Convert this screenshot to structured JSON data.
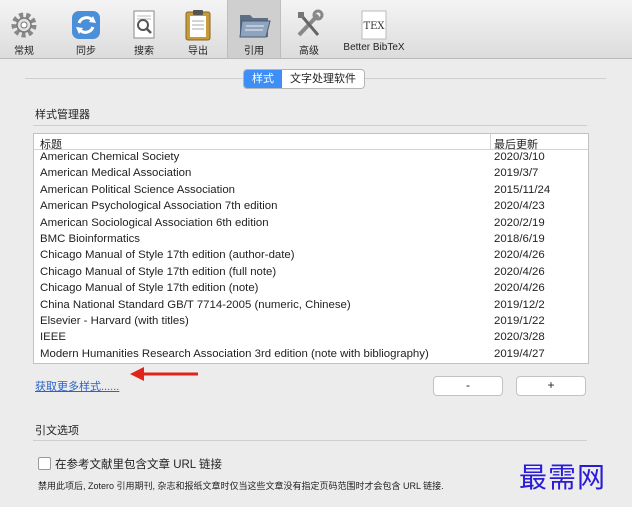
{
  "toolbar": {
    "items": [
      {
        "label": "常规",
        "icon": "gear-icon"
      },
      {
        "label": "同步",
        "icon": "sync-icon"
      },
      {
        "label": "搜索",
        "icon": "search-icon"
      },
      {
        "label": "导出",
        "icon": "clipboard-icon"
      },
      {
        "label": "引用",
        "icon": "folder-icon"
      },
      {
        "label": "高级",
        "icon": "tools-icon"
      },
      {
        "label": "Better BibTeX",
        "icon": "tex-icon",
        "icon_text": "TEX"
      }
    ],
    "selected": "引用"
  },
  "tabs": {
    "styles": "样式",
    "word_processors": "文字处理软件",
    "active": "样式"
  },
  "style_manager": {
    "title": "样式管理器",
    "columns": [
      "标题",
      "最后更新"
    ],
    "rows": [
      [
        "American Chemical Society",
        "2020/3/10"
      ],
      [
        "American Medical Association",
        "2019/3/7"
      ],
      [
        "American Political Science Association",
        "2015/11/24"
      ],
      [
        "American Psychological Association 7th edition",
        "2020/4/23"
      ],
      [
        "American Sociological Association 6th edition",
        "2020/2/19"
      ],
      [
        "BMC Bioinformatics",
        "2018/6/19"
      ],
      [
        "Chicago Manual of Style 17th edition (author-date)",
        "2020/4/26"
      ],
      [
        "Chicago Manual of Style 17th edition (full note)",
        "2020/4/26"
      ],
      [
        "Chicago Manual of Style 17th edition (note)",
        "2020/4/26"
      ],
      [
        "China National Standard GB/T 7714-2005 (numeric, Chinese)",
        "2019/12/2"
      ],
      [
        "Elsevier - Harvard (with titles)",
        "2019/1/22"
      ],
      [
        "IEEE",
        "2020/3/28"
      ],
      [
        "Modern Humanities Research Association 3rd edition (note with bibliography)",
        "2019/4/27"
      ]
    ],
    "get_more_link": "获取更多样式......",
    "remove_label": "-",
    "add_label": "+"
  },
  "citation_options": {
    "title": "引文选项",
    "checkbox_label": "在参考文献里包含文章 URL 链接",
    "checked": false,
    "note": "禁用此项后, Zotero 引用期刊, 杂志和报纸文章时仅当这些文章没有指定页码范围时才会包含 URL 链接."
  },
  "watermark": "最需网",
  "colors": {
    "accent": "#3d8ff7",
    "arrow": "#e2231a",
    "link": "#2a62c9",
    "watermark": "#2a1bd6"
  }
}
